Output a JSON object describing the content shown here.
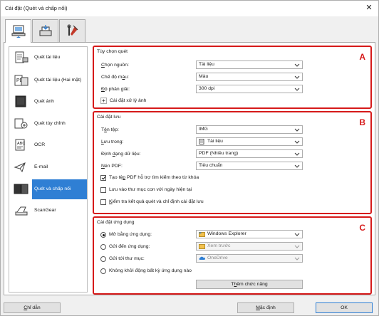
{
  "window": {
    "title": "Cài đặt (Quét và chấp nối)",
    "close_glyph": "✕"
  },
  "toptabs": [
    {
      "icon": "scan-computer-icon",
      "active": true
    },
    {
      "icon": "scan-device-icon",
      "active": false
    },
    {
      "icon": "tools-icon",
      "active": false
    }
  ],
  "sidebar": {
    "items": [
      {
        "label": "Quét tài liệu",
        "icon": "document-scan-icon"
      },
      {
        "label": "Quét tài liệu (Hai mặt)",
        "icon": "duplex-document-scan-icon"
      },
      {
        "label": "Quét ảnh",
        "icon": "photo-scan-icon"
      },
      {
        "label": "Quét tùy chỉnh",
        "icon": "custom-scan-icon"
      },
      {
        "label": "OCR",
        "icon": "ocr-icon"
      },
      {
        "label": "E-mail",
        "icon": "email-icon"
      },
      {
        "label": "Quét và chấp nối",
        "icon": "stitch-scan-icon",
        "selected": true
      },
      {
        "label": "ScanGear",
        "icon": "scangear-icon"
      }
    ]
  },
  "scan_options": {
    "title": "Tùy chọn quét",
    "letter": "A",
    "source_label_u": "C",
    "source_label_rest": "họn nguồn:",
    "source_value": "Tài liệu",
    "color_label_pre": "Chế độ m",
    "color_label_u": "à",
    "color_label_post": "u:",
    "color_value": "Màu",
    "res_label_u": "Đ",
    "res_label_rest": "ộ phân giải:",
    "res_value": "300 dpi",
    "image_proc_plus": "+",
    "image_proc_label": "Cài đặt xử lý ảnh"
  },
  "save_settings": {
    "title": "Cài đặt lưu",
    "letter": "B",
    "filename_label_pre": "T",
    "filename_label_u": "ê",
    "filename_label_post": "n tệp:",
    "filename_value": "IMG",
    "savein_label_u": "L",
    "savein_label_rest": "ưu trong:",
    "savein_value": "Tài liệu",
    "format_label_pre": "Định ",
    "format_label_u": "d",
    "format_label_post": "ạng dữ liệu:",
    "format_value": "PDF (Nhiều trang)",
    "pdf_comp_label_u": "N",
    "pdf_comp_label_rest": "én PDF:",
    "pdf_comp_value": "Tiêu chuẩn",
    "chk_searchable_pre": "Tạo tệ",
    "chk_searchable_u": "p",
    "chk_searchable_post": " PDF hỗ trợ tìm kiếm theo từ khóa",
    "chk_searchable_on": true,
    "chk_subfolder": "Lưu vào thư mục con với ngày hiện tại",
    "chk_subfolder_on": false,
    "chk_check_pre": "",
    "chk_check_u": "K",
    "chk_check_post": "iểm tra kết quả quét và chỉ định cài đặt lưu",
    "chk_check_on": false
  },
  "app_settings": {
    "title": "Cài đặt ứng dụng",
    "letter": "C",
    "opt_open_app": "Mở bằng ứng dụng:",
    "opt_open_app_value": "Windows Explorer",
    "opt_send_app": "Gửi đến ứng dụng:",
    "opt_send_app_value": "Xem trước",
    "opt_send_folder": "Gửi tới thư mục:",
    "opt_send_folder_value": "OneDrive",
    "opt_none": "Không khởi động bất kỳ ứng dụng nào",
    "more_funcs_pre": "T",
    "more_funcs_u": "h",
    "more_funcs_post": "êm chức năng"
  },
  "footer": {
    "help_u": "C",
    "help_rest": "hỉ dẫn",
    "defaults_u": "M",
    "defaults_rest": "ặc định",
    "ok": "OK"
  },
  "colors": {
    "accent": "#2f7fd4",
    "highlight_border": "#d61a1a"
  }
}
